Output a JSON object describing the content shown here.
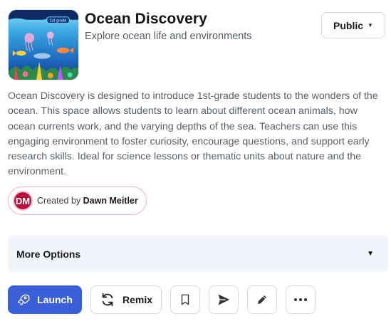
{
  "activity": {
    "title": "Ocean Discovery",
    "subtitle": "Explore ocean life and environments",
    "thumbnail_badge": "1st grade",
    "description": "Ocean Discovery is designed to introduce 1st-grade students to the wonders of the ocean. This space allows students to learn about different ocean animals, how ocean currents work, and the varying depths of the sea. Teachers can use this engaging environment to foster curiosity, encourage questions, and support early research skills. Ideal for science lessons or thematic units about nature and the environment."
  },
  "visibility": {
    "label": "Public",
    "icon": "caret-down-icon"
  },
  "creator": {
    "prefix": "Created by",
    "name": "Dawn Meitler",
    "initials": "DM"
  },
  "more_options": {
    "label": "More Options",
    "icon": "caret-down-icon"
  },
  "actions": {
    "launch_label": "Launch",
    "remix_label": "Remix",
    "icons": [
      "rocket-icon",
      "refresh-icon",
      "bookmark-icon",
      "send-icon",
      "pencil-icon",
      "ellipsis-icon"
    ]
  },
  "colors": {
    "primary": "#3a5fd9",
    "panel": "#f1f5fb",
    "avatar": "#b8123a",
    "pill_border": "#e7b7c6"
  }
}
